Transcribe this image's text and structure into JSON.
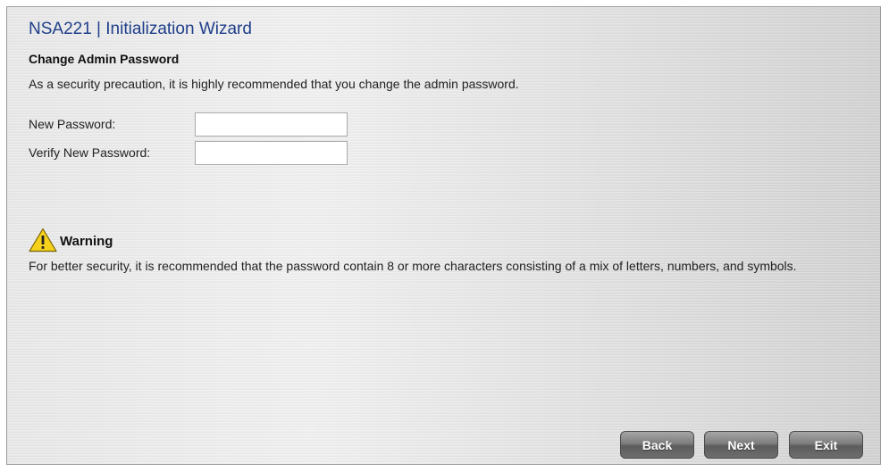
{
  "wizard": {
    "title": "NSA221 | Initialization Wizard",
    "section_title": "Change Admin Password",
    "intro": "As a security precaution, it is highly recommended that you change the admin password.",
    "fields": [
      {
        "label": "New Password:",
        "value": "",
        "placeholder": ""
      },
      {
        "label": "Verify New Password:",
        "value": "",
        "placeholder": ""
      }
    ],
    "warning": {
      "icon": "warning-triangle-icon",
      "title": "Warning",
      "text": "For better security, it is recommended that the password contain 8 or more characters consisting of a mix of letters, numbers, and symbols."
    },
    "buttons": {
      "back": "Back",
      "next": "Next",
      "exit": "Exit"
    },
    "colors": {
      "title": "#1f3f8a",
      "button_dark": "#5c5c5c",
      "warning_yellow": "#f6d21c"
    }
  }
}
